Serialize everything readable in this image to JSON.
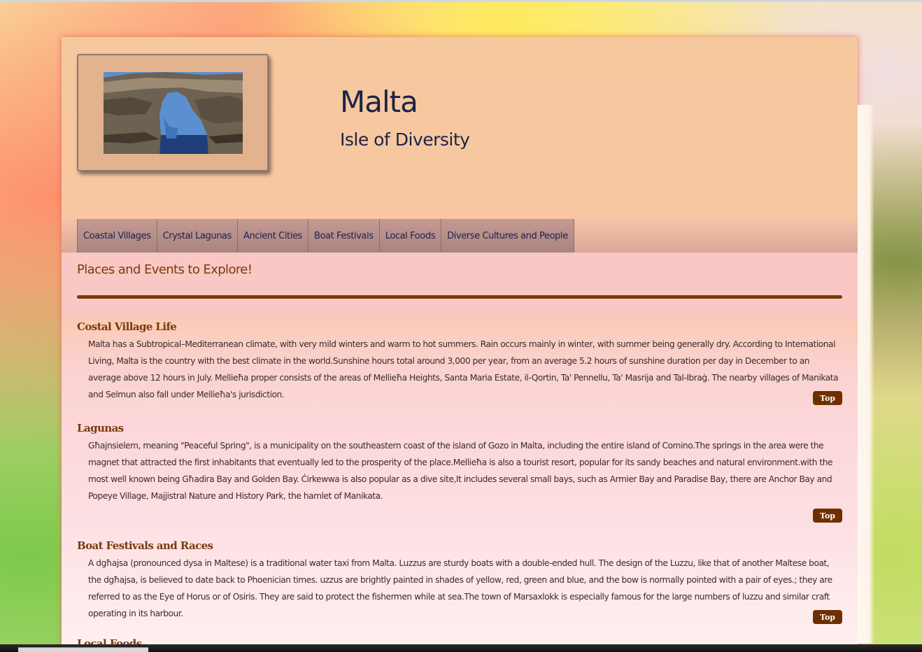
{
  "header": {
    "title": "Malta",
    "subtitle": "Isle of Diversity",
    "photo_alt": "Azure Window rock arch"
  },
  "nav": {
    "items": [
      {
        "label": "Coastal Villages"
      },
      {
        "label": "Crystal Lagunas"
      },
      {
        "label": "Ancient Cities"
      },
      {
        "label": "Boat Festivals"
      },
      {
        "label": "Local Foods"
      },
      {
        "label": "Diverse Cultures and People"
      }
    ]
  },
  "main": {
    "heading": "Places and Events to Explore!",
    "articles": [
      {
        "title": "Costal Village Life",
        "text": "Malta has a Subtropical–Mediterranean climate, with very mild winters and warm to hot summers. Rain occurs mainly in winter, with summer being generally dry. According to International Living, Malta is the country with the best climate in the world.Sunshine hours total around 3,000 per year, from an average 5.2 hours of sunshine duration per day in December to an average above 12 hours in July. Mellieħa proper consists of the areas of Mellieħa Heights, Santa Maria Estate, il-Qortin, Ta' Pennellu, Ta' Masrija and Tal-Ibraġ. The nearby villages of Manikata and Selmun also fall under Mellieħa's jurisdiction.",
        "top_label": "Top"
      },
      {
        "title": "Lagunas",
        "text": "Għajnsielem, meaning \"Peaceful Spring\", is a municipality on the southeastern coast of the island of Gozo in Malta, including the entire island of Comino.The springs in the area were the magnet that attracted the first inhabitants that eventually led to the prosperity of the place.Mellieħa is also a tourist resort, popular for its sandy beaches and natural environment.with the most well known being Għadira Bay and Golden Bay. Ċirkewwa is also popular as a dive site,It includes several small bays, such as Armier Bay and Paradise Bay, there are Anchor Bay and Popeye Village, Majjistral Nature and History Park, the hamlet of Manikata.",
        "top_label": "Top"
      },
      {
        "title": "Boat Festivals and Races",
        "text": "A dgħajsa (pronounced dysa in Maltese) is a traditional water taxi from Malta. Luzzus are sturdy boats with a double-ended hull. The design of the Luzzu, like that of another Maltese boat, the dgħajsa, is believed to date back to Phoenician times. uzzus are brightly painted in shades of yellow, red, green and blue, and the bow is normally pointed with a pair of eyes.; they are referred to as the Eye of Horus or of Osiris. They are said to protect the fishermen while at sea.The town of Marsaxlokk is especially famous for the large numbers of luzzu and similar craft operating in its harbour.",
        "top_label": "Top"
      }
    ],
    "partial_heading": "Local Foods"
  },
  "colors": {
    "heading_brown": "#7a3a0c",
    "title_navy": "#1b2347",
    "button_brown": "#6e2f00"
  }
}
